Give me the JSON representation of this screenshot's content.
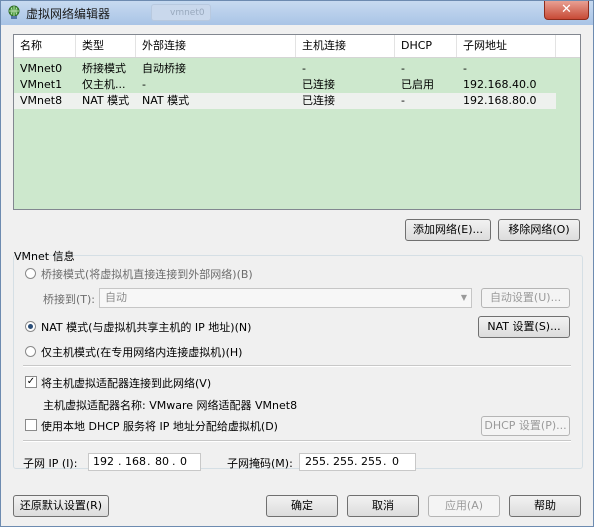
{
  "window": {
    "title": "虚拟网络编辑器",
    "ghost_tab": "vmnet0",
    "close_glyph": "✕"
  },
  "table": {
    "headers": [
      "名称",
      "类型",
      "外部连接",
      "主机连接",
      "DHCP",
      "子网地址"
    ],
    "rows": [
      {
        "name": "VMnet0",
        "type": "桥接模式",
        "external": "自动桥接",
        "host": "-",
        "dhcp": "-",
        "subnet": "-"
      },
      {
        "name": "VMnet1",
        "type": "仅主机...",
        "external": "-",
        "host": "已连接",
        "dhcp": "已启用",
        "subnet": "192.168.40.0"
      },
      {
        "name": "VMnet8",
        "type": "NAT 模式",
        "external": "NAT 模式",
        "host": "已连接",
        "dhcp": "-",
        "subnet": "192.168.80.0"
      }
    ],
    "selected_row": "VMnet8"
  },
  "buttons": {
    "add_network": "添加网络(E)...",
    "remove_network": "移除网络(O)",
    "auto_settings": "自动设置(U)...",
    "nat_settings": "NAT 设置(S)...",
    "dhcp_settings": "DHCP 设置(P)...",
    "restore_defaults": "还原默认设置(R)",
    "ok": "确定",
    "cancel": "取消",
    "apply": "应用(A)",
    "help": "帮助"
  },
  "vmnet_info": {
    "group_title": "VMnet 信息",
    "bridged_label": "桥接模式(将虚拟机直接连接到外部网络)(B)",
    "bridged_to_label": "桥接到(T):",
    "bridged_to_value": "自动",
    "nat_label": "NAT 模式(与虚拟机共享主机的 IP 地址)(N)",
    "host_only_label": "仅主机模式(在专用网络内连接虚拟机)(H)",
    "selected_mode": "nat",
    "connect_adapter_label": "将主机虚拟适配器连接到此网络(V)",
    "connect_adapter_checked": true,
    "adapter_name_text": "主机虚拟适配器名称: VMware 网络适配器 VMnet8",
    "local_dhcp_label": "使用本地 DHCP 服务将 IP 地址分配给虚拟机(D)",
    "local_dhcp_checked": false,
    "subnet_ip_label": "子网 IP (I):",
    "subnet_ip": [
      "192",
      "168",
      "80",
      "0"
    ],
    "subnet_mask_label": "子网掩码(M):",
    "subnet_mask": [
      "255",
      "255",
      "255",
      "0"
    ]
  },
  "colors": {
    "list_background": "#cde8cd",
    "titlebar": "#b7cfeb",
    "selected_radio_dot": "#2b4e78"
  }
}
